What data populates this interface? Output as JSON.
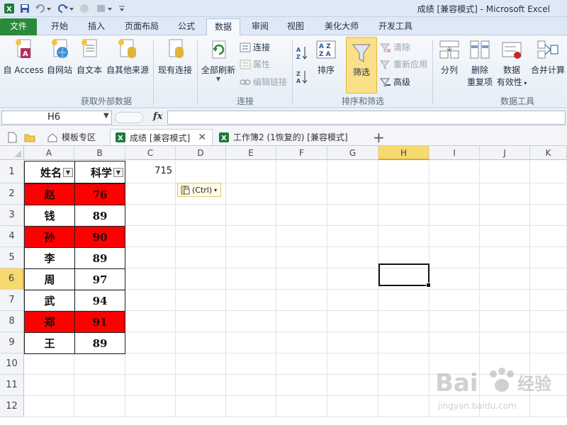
{
  "window": {
    "title": "成绩  [兼容模式]  -  Microsoft Excel"
  },
  "ribbon_tabs": [
    {
      "label": "文件"
    },
    {
      "label": "开始"
    },
    {
      "label": "插入"
    },
    {
      "label": "页面布局"
    },
    {
      "label": "公式"
    },
    {
      "label": "数据"
    },
    {
      "label": "审阅"
    },
    {
      "label": "视图"
    },
    {
      "label": "美化大师"
    },
    {
      "label": "开发工具"
    }
  ],
  "ribbon": {
    "groups": {
      "external": "获取外部数据",
      "connections": "连接",
      "sort_filter": "排序和筛选",
      "data_tools": "数据工具"
    },
    "buttons": {
      "access": "自 Access",
      "web": "自网站",
      "text": "自文本",
      "other": "自其他来源",
      "existing": "现有连接",
      "refresh": "全部刷新",
      "connections": "连接",
      "properties": "属性",
      "edit_links": "编辑链接",
      "sort": "排序",
      "filter": "筛选",
      "clear": "清除",
      "reapply": "重新应用",
      "advanced": "高级",
      "split": "分列",
      "remove_dup_1": "删除",
      "remove_dup_2": "重复项",
      "validation_1": "数据",
      "validation_2": "有效性",
      "consolidate": "合并计算"
    }
  },
  "formula_bar": {
    "name_box": "H6",
    "fx": "fx",
    "formula": ""
  },
  "doc_tabs": [
    {
      "label": "模板专区"
    },
    {
      "label": "成绩  [兼容模式]"
    },
    {
      "label": "工作簿2 (1恢复的)  [兼容模式]"
    }
  ],
  "columns": [
    "A",
    "B",
    "C",
    "D",
    "E",
    "F",
    "G",
    "H",
    "I",
    "J",
    "K"
  ],
  "rows": [
    "1",
    "2",
    "3",
    "4",
    "5",
    "6",
    "7",
    "8",
    "9",
    "10",
    "11",
    "12"
  ],
  "sheet": {
    "header": {
      "name": "姓名",
      "score": "科学"
    },
    "c1": "715",
    "paste_options": "(Ctrl)",
    "data": [
      {
        "name": "赵",
        "score": "76",
        "highlight": true
      },
      {
        "name": "钱",
        "score": "89",
        "highlight": false
      },
      {
        "name": "孙",
        "score": "90",
        "highlight": true
      },
      {
        "name": "李",
        "score": "89",
        "highlight": false
      },
      {
        "name": "周",
        "score": "97",
        "highlight": false
      },
      {
        "name": "武",
        "score": "94",
        "highlight": false
      },
      {
        "name": "郑",
        "score": "91",
        "highlight": true
      },
      {
        "name": "王",
        "score": "89",
        "highlight": false
      }
    ],
    "highlight_color": "#ff0000"
  },
  "watermark": {
    "line1": "经验",
    "line2": "jingyan.baidu.com"
  }
}
